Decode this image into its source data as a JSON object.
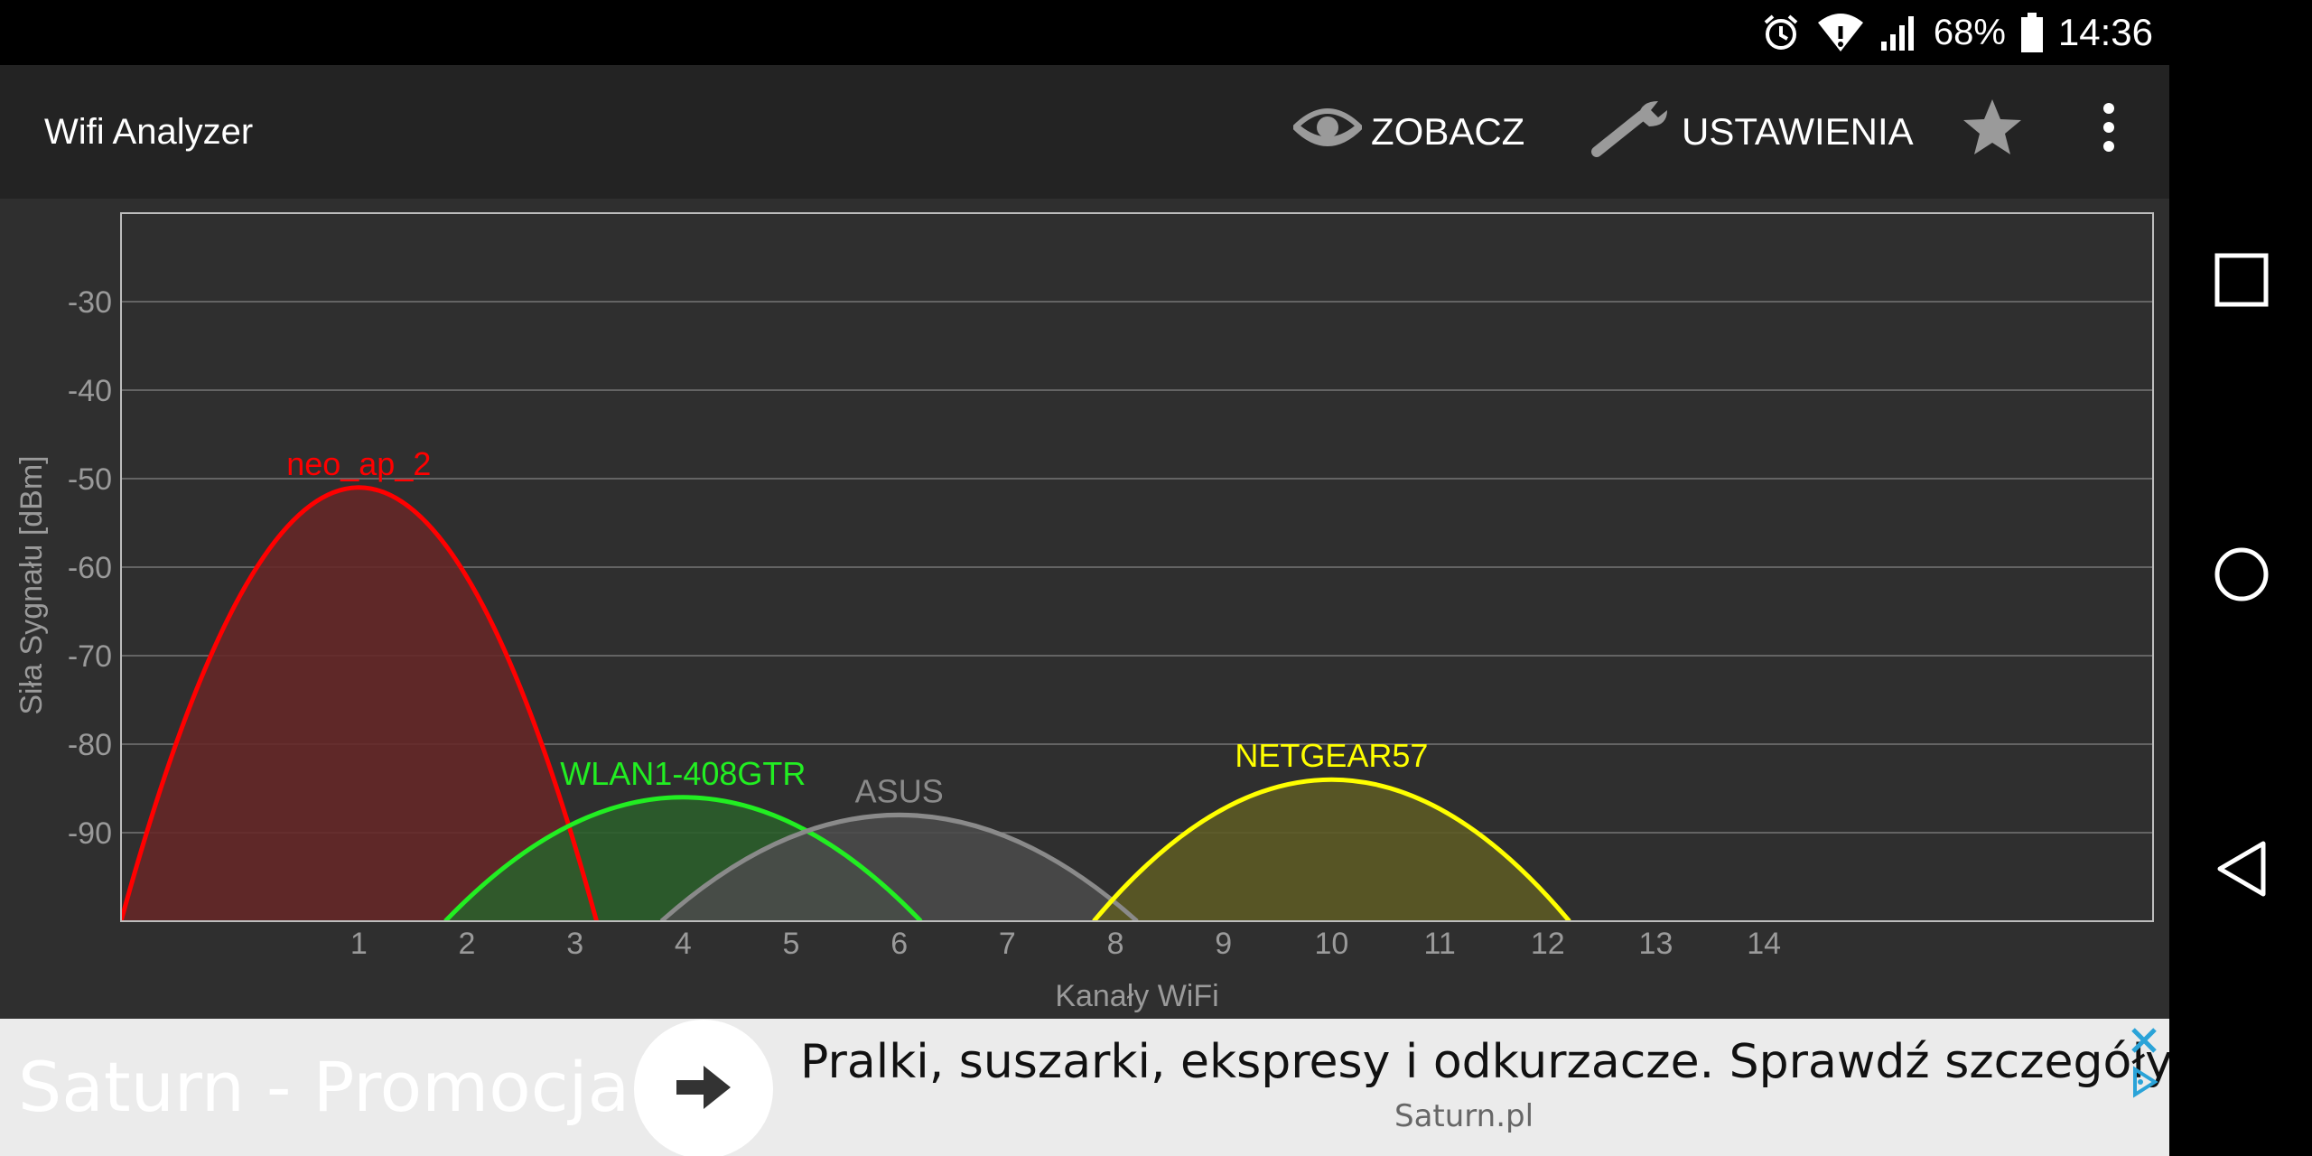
{
  "status_bar": {
    "battery_percent": "68%",
    "time": "14:36",
    "icons": [
      "alarm-icon",
      "wifi-icon",
      "cellular-signal-icon",
      "battery-icon"
    ]
  },
  "action_bar": {
    "title": "Wifi Analyzer",
    "view_label": "ZOBACZ",
    "settings_label": "USTAWIENIA",
    "icons": [
      "eye-icon",
      "wrench-icon",
      "star-icon",
      "overflow-menu-icon"
    ]
  },
  "chart_data": {
    "type": "line",
    "title": "",
    "xlabel": "Kanały WiFi",
    "ylabel": "Siła Sygnału [dBm]",
    "xlim": [
      -1.2,
      17.6
    ],
    "ylim": [
      -100,
      -20
    ],
    "x_ticks": [
      1,
      2,
      3,
      4,
      5,
      6,
      7,
      8,
      9,
      10,
      11,
      12,
      13,
      14
    ],
    "y_ticks": [
      -30,
      -40,
      -50,
      -60,
      -70,
      -80,
      -90
    ],
    "grid": true,
    "series": [
      {
        "name": "neo_ap_2",
        "channel": 1,
        "signal_dbm": -51,
        "color": "#ff0000",
        "fill": "#652828"
      },
      {
        "name": "WLAN1-408GTR",
        "channel": 4,
        "signal_dbm": -86,
        "color": "#22ee22",
        "fill": "#2b5e2b"
      },
      {
        "name": "ASUS",
        "channel": 6,
        "signal_dbm": -88,
        "color": "#8a8a8a",
        "fill": "#4a4a4a"
      },
      {
        "name": "NETGEAR57",
        "channel": 10,
        "signal_dbm": -84,
        "color": "#ffff00",
        "fill": "#5c5a25"
      }
    ]
  },
  "ad": {
    "headline": "Saturn - Promocja",
    "text": "Pralki, suszarki, ekspresy i odkurzacze. Sprawdź szczegóły!",
    "domain": "Saturn.pl"
  },
  "nav_bar": {
    "icons": [
      "recents-icon",
      "home-icon",
      "back-icon"
    ]
  },
  "colors": {
    "background": "#2f2f2f",
    "action_bar": "#232323",
    "grid_line": "#777777",
    "axis_text": "#9a9a9a"
  }
}
